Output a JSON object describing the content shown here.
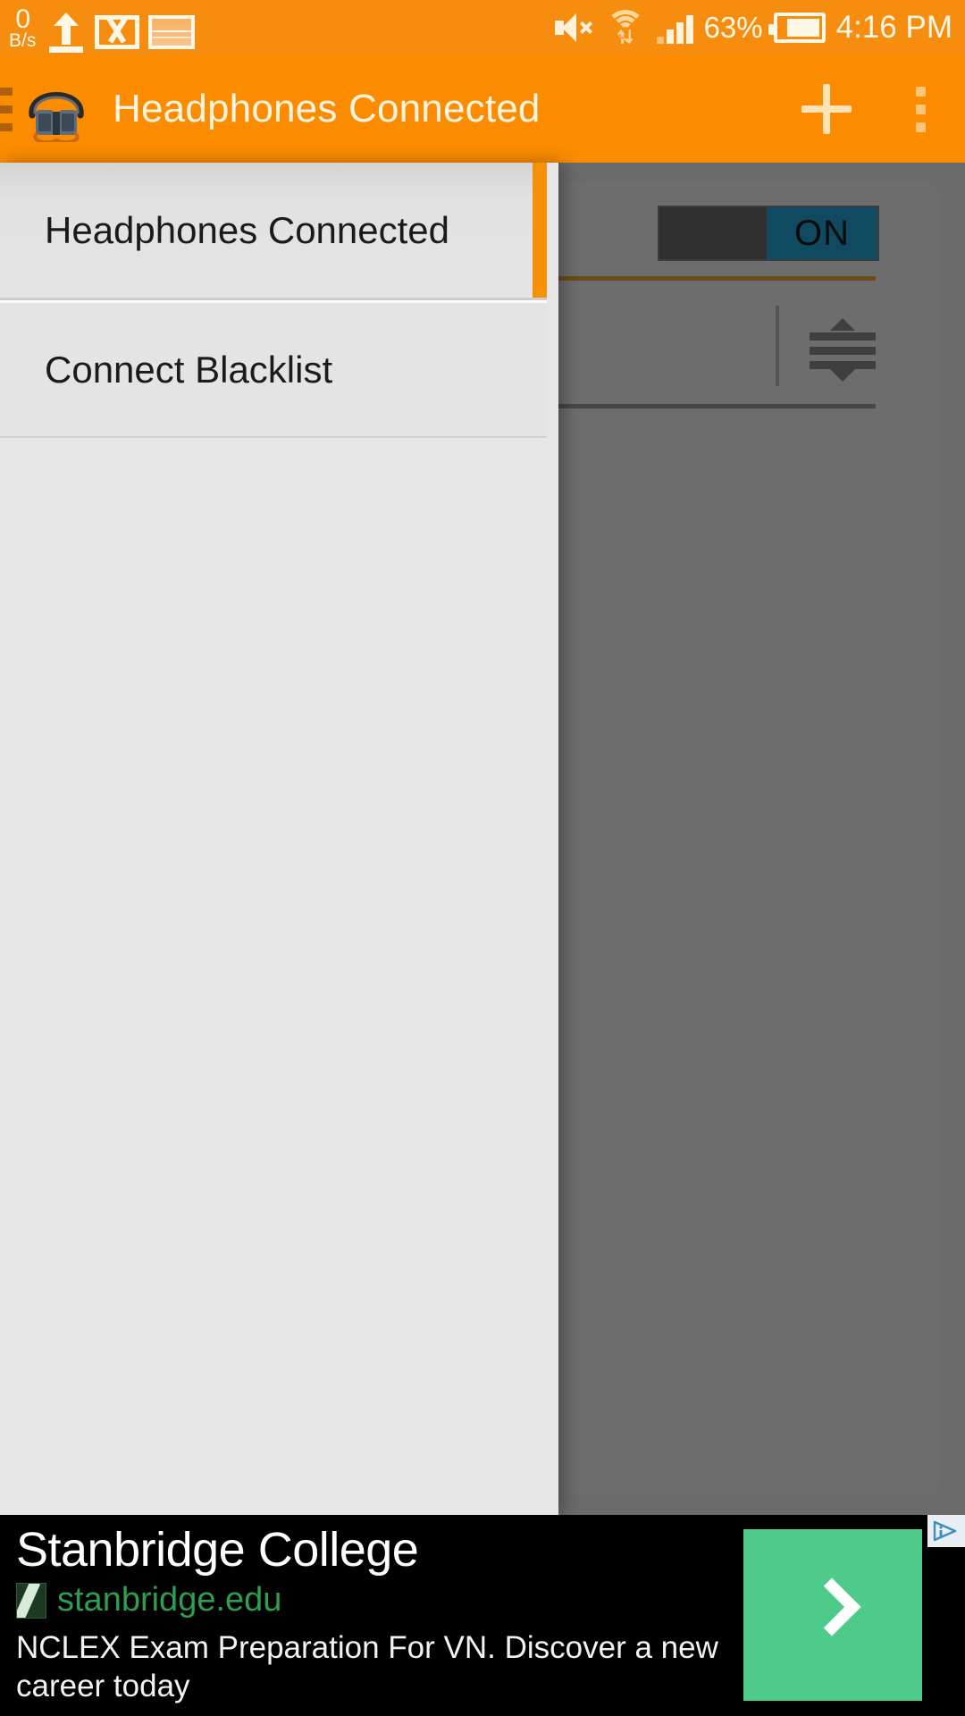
{
  "status_bar": {
    "network_speed_value": "0",
    "network_speed_unit": "B/s",
    "icons": [
      "upload-icon",
      "gmail-icon",
      "screenshot-icon",
      "volume-mute-icon",
      "wifi-icon",
      "cellular-signal-icon"
    ],
    "battery_percent": "63%",
    "clock": "4:16 PM",
    "background_color": "#f68d0e",
    "foreground_color": "#fff7e6"
  },
  "action_bar": {
    "title": "Headphones Connected",
    "menu_icon": "hamburger-icon",
    "app_icon": "headphones-icon",
    "add_label": "+",
    "overflow_label": "⋮",
    "background_color": "#fb8c00",
    "title_color": "#fff4df"
  },
  "drawer": {
    "items": [
      {
        "label": "Headphones Connected",
        "selected": true
      },
      {
        "label": "Connect Blacklist",
        "selected": false
      }
    ],
    "background_color": "#e6e6e6",
    "accent_color": "#f79009"
  },
  "background_content": {
    "toggle": {
      "state_label": "ON",
      "track_color": "#2f2f2f",
      "knob_color": "#0f4a61"
    },
    "drag_handle_icon": "reorder-handle-icon",
    "scrim_color": "#6b6b6b"
  },
  "ad": {
    "headline": "Stanbridge College",
    "url": "stanbridge.edu",
    "description": "NCLEX Exam Preparation For VN. Discover a new career today",
    "cta_icon": "chevron-right-icon",
    "cta_color": "#4ecb8a",
    "url_color": "#2f9e4f",
    "adchoices_icon": "adchoices-icon",
    "favicon_icon": "stanbridge-favicon"
  }
}
